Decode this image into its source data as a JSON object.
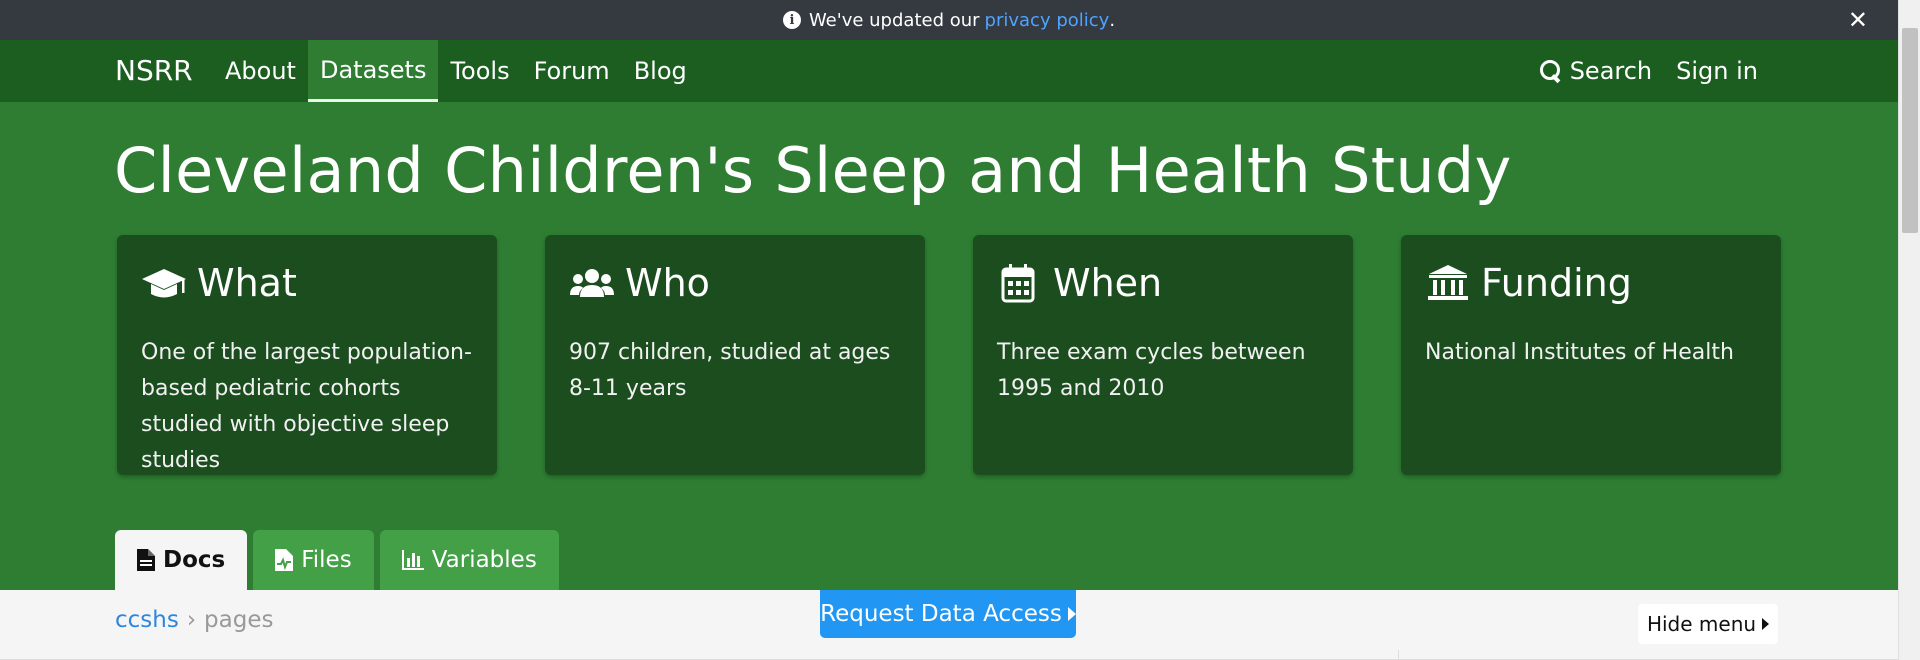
{
  "announcement": {
    "text": "We've updated our",
    "link": "privacy policy",
    "suffix": ".",
    "close_glyph": "✕"
  },
  "navbar": {
    "brand": "NSRR",
    "links": [
      {
        "label": "About"
      },
      {
        "label": "Datasets",
        "active": true
      },
      {
        "label": "Tools"
      },
      {
        "label": "Forum"
      },
      {
        "label": "Blog"
      }
    ],
    "search_label": "Search",
    "signin_label": "Sign in"
  },
  "hero": {
    "title": "Cleveland Children's Sleep and Health Study",
    "cards": [
      {
        "icon": "graduation-cap-icon",
        "title": "What",
        "body": "One of the largest population-based pediatric cohorts studied with objective sleep studies"
      },
      {
        "icon": "users-icon",
        "title": "Who",
        "body": "907 children, studied at ages 8-11 years"
      },
      {
        "icon": "calendar-icon",
        "title": "When",
        "body": "Three exam cycles between 1995 and 2010"
      },
      {
        "icon": "university-icon",
        "title": "Funding",
        "body": "National Institutes of Health"
      }
    ]
  },
  "tabs": [
    {
      "label": "Docs",
      "icon": "file-icon",
      "active": true
    },
    {
      "label": "Files",
      "icon": "file-medical-icon"
    },
    {
      "label": "Variables",
      "icon": "chart-bar-icon"
    }
  ],
  "subbar": {
    "breadcrumb": [
      "ccshs",
      "pages"
    ],
    "separator": "›",
    "request_label": "Request Data Access",
    "hide_menu_label": "Hide menu"
  },
  "colors": {
    "announce_bg": "#343a40",
    "navbar_bg": "#1b5e20",
    "hero_bg": "#2e7d32",
    "card_bg": "#1b4d1e",
    "tab_bg": "#43a047",
    "link_blue": "#2e86de",
    "button_blue": "#2196f3"
  }
}
